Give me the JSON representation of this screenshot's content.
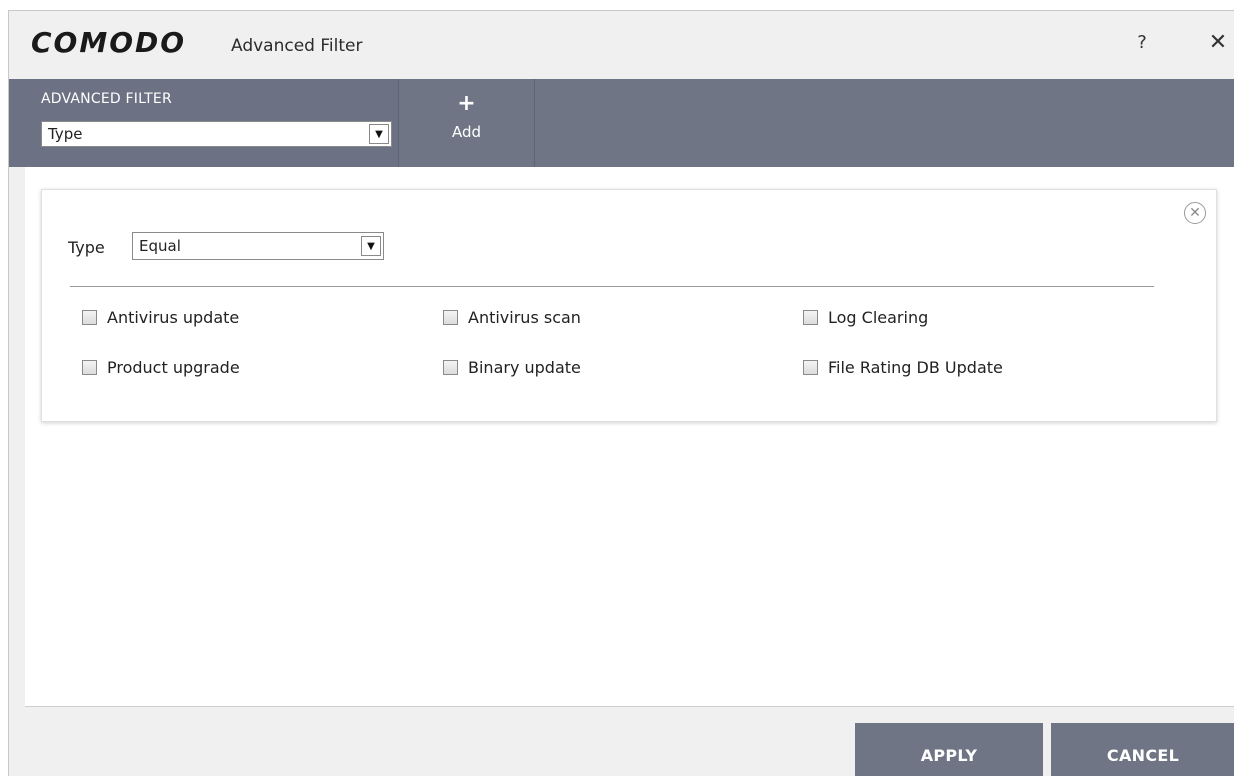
{
  "window": {
    "logo": "COMODO",
    "title": "Advanced Filter",
    "help_label": "?",
    "close_label": "✕"
  },
  "toolbar": {
    "filter_heading": "ADVANCED FILTER",
    "filter_select_value": "Type",
    "add_icon": "+",
    "add_label": "Add"
  },
  "card": {
    "remove_icon": "✕",
    "type_label": "Type",
    "type_select_value": "Equal",
    "options": [
      {
        "label": "Antivirus update",
        "checked": false
      },
      {
        "label": "Antivirus scan",
        "checked": false
      },
      {
        "label": "Log Clearing",
        "checked": false
      },
      {
        "label": "Product upgrade",
        "checked": false
      },
      {
        "label": "Binary update",
        "checked": false
      },
      {
        "label": "File Rating DB Update",
        "checked": false
      }
    ]
  },
  "footer": {
    "apply_label": "APPLY",
    "cancel_label": "CANCEL"
  },
  "colors": {
    "toolbar_bg": "#6f7584",
    "window_bg": "#f0f0f0",
    "content_bg": "#ffffff"
  }
}
